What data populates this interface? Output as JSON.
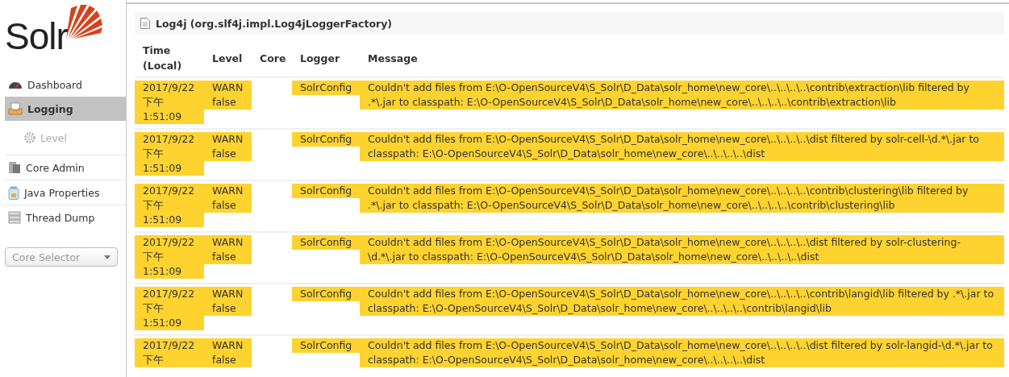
{
  "logo": {
    "text": "Solr"
  },
  "sidebar": {
    "items": [
      {
        "label": "Dashboard",
        "selected": false
      },
      {
        "label": "Logging",
        "selected": true,
        "children": [
          {
            "label": "Level",
            "selected": false,
            "disabled": true
          }
        ]
      },
      {
        "label": "Core Admin",
        "selected": false
      },
      {
        "label": "Java Properties",
        "selected": false
      },
      {
        "label": "Thread Dump",
        "selected": false
      }
    ],
    "core_selector": {
      "placeholder": "Core Selector"
    }
  },
  "panel": {
    "title": "Log4j (org.slf4j.impl.Log4jLoggerFactory)"
  },
  "table": {
    "columns": [
      "Time (Local)",
      "Level",
      "Core",
      "Logger",
      "Message"
    ],
    "rows": [
      {
        "time": [
          "2017/9/22",
          "下午",
          "1:51:09"
        ],
        "level": [
          "WARN",
          "false"
        ],
        "logger": "SolrConfig",
        "message": "Couldn't add files from E:\\O-OpenSourceV4\\S_Solr\\D_Data\\solr_home\\new_core\\..\\..\\..\\..\\contrib\\extraction\\lib filtered by .*\\.jar to classpath: E:\\O-OpenSourceV4\\S_Solr\\D_Data\\solr_home\\new_core\\..\\..\\..\\..\\contrib\\extraction\\lib"
      },
      {
        "time": [
          "2017/9/22",
          "下午",
          "1:51:09"
        ],
        "level": [
          "WARN",
          "false"
        ],
        "logger": "SolrConfig",
        "message": "Couldn't add files from E:\\O-OpenSourceV4\\S_Solr\\D_Data\\solr_home\\new_core\\..\\..\\..\\..\\dist filtered by solr-cell-\\d.*\\.jar to classpath: E:\\O-OpenSourceV4\\S_Solr\\D_Data\\solr_home\\new_core\\..\\..\\..\\..\\dist"
      },
      {
        "time": [
          "2017/9/22",
          "下午",
          "1:51:09"
        ],
        "level": [
          "WARN",
          "false"
        ],
        "logger": "SolrConfig",
        "message": "Couldn't add files from E:\\O-OpenSourceV4\\S_Solr\\D_Data\\solr_home\\new_core\\..\\..\\..\\..\\contrib\\clustering\\lib filtered by .*\\.jar to classpath: E:\\O-OpenSourceV4\\S_Solr\\D_Data\\solr_home\\new_core\\..\\..\\..\\..\\contrib\\clustering\\lib"
      },
      {
        "time": [
          "2017/9/22",
          "下午",
          "1:51:09"
        ],
        "level": [
          "WARN",
          "false"
        ],
        "logger": "SolrConfig",
        "message": "Couldn't add files from E:\\O-OpenSourceV4\\S_Solr\\D_Data\\solr_home\\new_core\\..\\..\\..\\..\\dist filtered by solr-clustering-\\d.*\\.jar to classpath: E:\\O-OpenSourceV4\\S_Solr\\D_Data\\solr_home\\new_core\\..\\..\\..\\..\\dist"
      },
      {
        "time": [
          "2017/9/22",
          "下午",
          "1:51:09"
        ],
        "level": [
          "WARN",
          "false"
        ],
        "logger": "SolrConfig",
        "message": "Couldn't add files from E:\\O-OpenSourceV4\\S_Solr\\D_Data\\solr_home\\new_core\\..\\..\\..\\..\\contrib\\langid\\lib filtered by .*\\.jar to classpath: E:\\O-OpenSourceV4\\S_Solr\\D_Data\\solr_home\\new_core\\..\\..\\..\\..\\contrib\\langid\\lib"
      },
      {
        "time": [
          "2017/9/22",
          "下午"
        ],
        "level": [
          "WARN",
          "false"
        ],
        "logger": "SolrConfig",
        "message": "Couldn't add files from E:\\O-OpenSourceV4\\S_Solr\\D_Data\\solr_home\\new_core\\..\\..\\..\\..\\dist filtered by solr-langid-\\d.*\\.jar to classpath: E:\\O-OpenSourceV4\\S_Solr\\D_Data\\solr_home\\new_core\\..\\..\\..\\..\\dist"
      }
    ]
  }
}
